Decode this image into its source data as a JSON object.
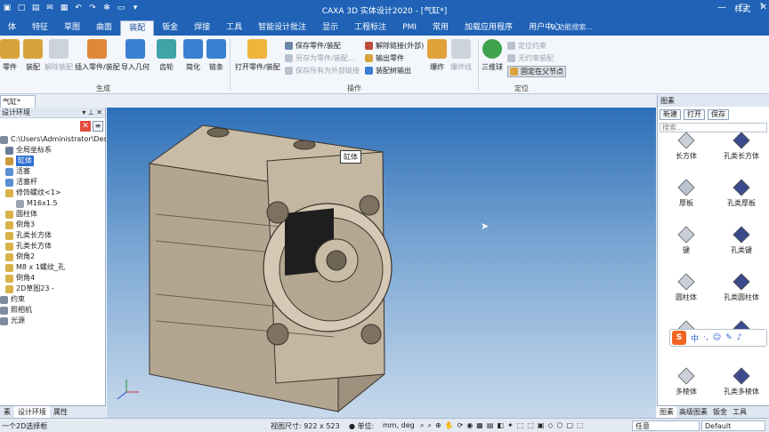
{
  "title": "CAXA 3D 实体设计2020 - [气缸*]",
  "quick_access": [
    "app-icon",
    "new-icon",
    "open-icon",
    "mail-icon",
    "save-icon",
    "undo-icon",
    "redo-icon",
    "gear-icon",
    "print-icon",
    "dropdown-icon"
  ],
  "window_controls": {
    "min": "—",
    "max": "□",
    "close": "✕"
  },
  "tabs": [
    "体",
    "特征",
    "草图",
    "曲面",
    "装配",
    "钣金",
    "焊接",
    "工具",
    "智能设计批注",
    "显示",
    "工程标注",
    "PMI",
    "常用",
    "加载应用程序",
    "用户中心"
  ],
  "active_tab": "装配",
  "search_placeholder": "功能搜索...",
  "tabs_right": {
    "style": "样式",
    "help": "?"
  },
  "ribbon": {
    "gen_buttons": [
      {
        "label": "零件",
        "disabled": false
      },
      {
        "label": "装配",
        "disabled": false
      },
      {
        "label": "解除装配",
        "disabled": true
      },
      {
        "label": "插入零件/装配",
        "disabled": false
      },
      {
        "label": "导入几何",
        "disabled": false
      },
      {
        "label": "齿轮",
        "disabled": false
      },
      {
        "label": "简化",
        "disabled": false
      },
      {
        "label": "链条",
        "disabled": false
      }
    ],
    "gen_label": "生成",
    "op_big": "打开零件/装配",
    "op_small": [
      {
        "label": "保存零件/装配",
        "disabled": false
      },
      {
        "label": "另存为零件/装配...",
        "disabled": true
      },
      {
        "label": "保存所有为外部链接",
        "disabled": true
      },
      {
        "label": "解除链接(外部)",
        "disabled": false
      },
      {
        "label": "输出零件",
        "disabled": false
      },
      {
        "label": "装配树输出",
        "disabled": false
      }
    ],
    "op_extra": [
      {
        "label": "爆炸",
        "disabled": false
      },
      {
        "label": "爆炸线",
        "disabled": true
      }
    ],
    "op_label": "操作",
    "pos_big": "三维球",
    "pos_small": [
      {
        "label": "定位约束",
        "disabled": true
      },
      {
        "label": "无约束装配",
        "disabled": true
      },
      {
        "label": "固定在父节点",
        "disabled": false
      }
    ],
    "pos_label": "定位"
  },
  "doc_tab": "气缸*",
  "left_panel": {
    "header": "设计环境",
    "tree": [
      {
        "label": "C:\\Users\\Administrator\\Desktop",
        "indent": 0,
        "color": "#7f8c9d"
      },
      {
        "label": "全局坐标系",
        "indent": 1,
        "color": "#6b7d96"
      },
      {
        "label": "缸体",
        "indent": 1,
        "color": "#c89b3c",
        "selected": true
      },
      {
        "label": "活塞",
        "indent": 1,
        "color": "#5a8fd4"
      },
      {
        "label": "活塞杆",
        "indent": 1,
        "color": "#5a8fd4"
      },
      {
        "label": "修饰螺纹<1>",
        "indent": 1,
        "color": "#d8b34a"
      },
      {
        "label": "M16x1.5",
        "indent": 3,
        "color": "#9aa4b3"
      },
      {
        "label": "圆柱体",
        "indent": 1,
        "color": "#d8b34a"
      },
      {
        "label": "倒角3",
        "indent": 1,
        "color": "#d8b34a"
      },
      {
        "label": "孔类长方体",
        "indent": 1,
        "color": "#d8b34a"
      },
      {
        "label": "孔类长方体",
        "indent": 1,
        "color": "#d8b34a"
      },
      {
        "label": "倒角2",
        "indent": 1,
        "color": "#d8b34a"
      },
      {
        "label": "M8 x 1螺纹_孔",
        "indent": 1,
        "color": "#d8b34a"
      },
      {
        "label": "倒角4",
        "indent": 1,
        "color": "#d8b34a"
      },
      {
        "label": "2D草图23 -",
        "indent": 1,
        "color": "#d8b34a"
      },
      {
        "label": "约束",
        "indent": 0,
        "color": "#7f8c9d"
      },
      {
        "label": "照相机",
        "indent": 0,
        "color": "#7f8c9d"
      },
      {
        "label": "光源",
        "indent": 0,
        "color": "#7f8c9d"
      }
    ],
    "bottom_tabs": [
      "素",
      "设计环境",
      "属性"
    ]
  },
  "viewport": {
    "tooltip": "缸体"
  },
  "right_panel": {
    "header": "图素",
    "tools": [
      "新建",
      "打开",
      "保存"
    ],
    "search": "搜索...",
    "elements": [
      "长方体",
      "孔类长方体",
      "厚板",
      "孔类厚板",
      "键",
      "孔类键",
      "圆柱体",
      "孔类圆柱体",
      "",
      "",
      "多棱体",
      "孔类多棱体"
    ],
    "bottom_tabs": [
      "图素",
      "高级图素",
      "钣金",
      "工具"
    ]
  },
  "ime": {
    "logo": "S",
    "mode": "中"
  },
  "status": {
    "hint": "一个2D选择框",
    "view_size": "视图尺寸: 922 x 523",
    "unit_label": "单位:",
    "unit_value": "mm, deg",
    "filter": "任意",
    "scheme": "Default"
  }
}
